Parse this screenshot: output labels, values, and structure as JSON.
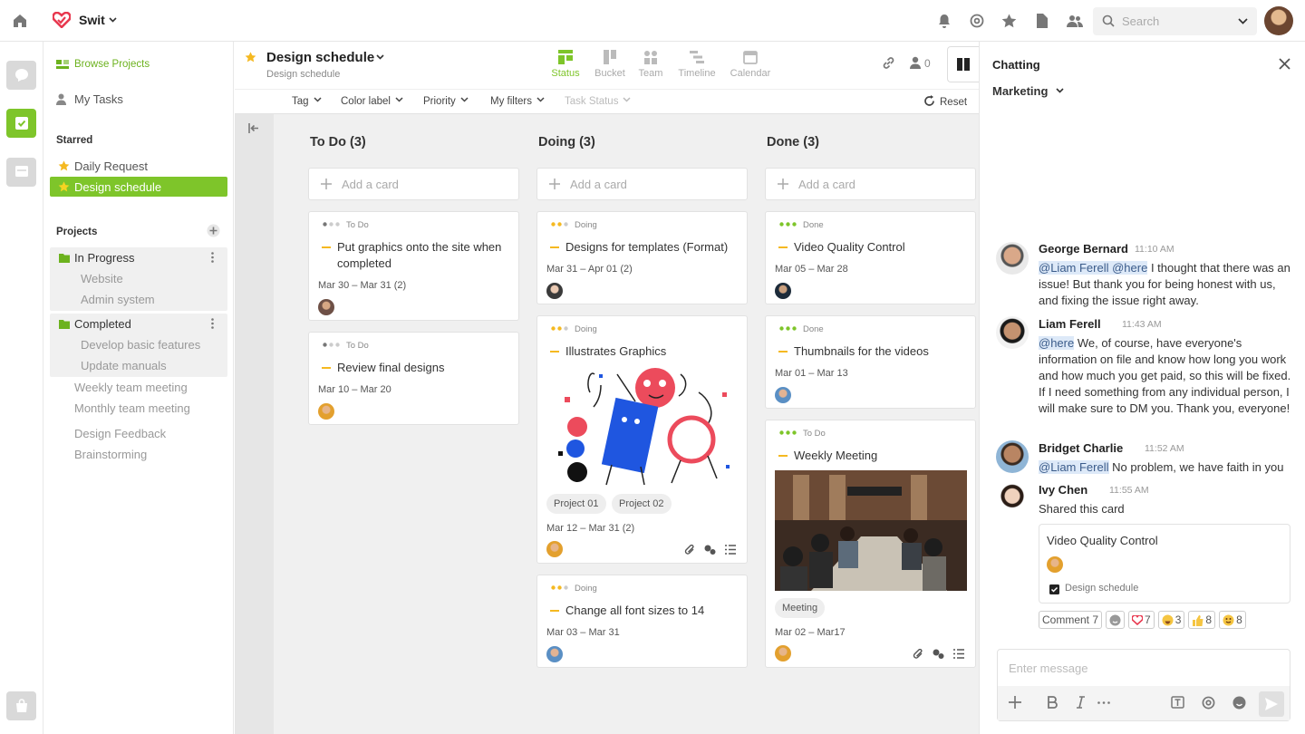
{
  "app": {
    "name": "Swit",
    "accent": "#7ec52a",
    "logo_color": "#e8384f"
  },
  "search": {
    "placeholder": "Search"
  },
  "sidebar": {
    "browse": "Browse Projects",
    "my_tasks": "My Tasks",
    "starred_title": "Starred",
    "starred": [
      {
        "label": "Daily Request"
      },
      {
        "label": "Design schedule",
        "selected": true
      }
    ],
    "projects_title": "Projects",
    "groups": [
      {
        "label": "In Progress",
        "items": [
          "Website",
          "Admin system"
        ]
      },
      {
        "label": "Completed",
        "items": [
          "Develop basic features",
          "Update manuals"
        ]
      }
    ],
    "others": [
      "Weekly team meeting",
      "Monthly team meeting",
      "Design Feedback",
      "Brainstorming"
    ]
  },
  "main": {
    "title": "Design schedule",
    "subtitle": "Design schedule",
    "views": [
      "Status",
      "Bucket",
      "Team",
      "Timeline",
      "Calendar"
    ],
    "active_view": "Status",
    "member_count": "0",
    "filters": [
      "Tag",
      "Color label",
      "Priority",
      "My filters",
      "Task Status"
    ],
    "reset": "Reset",
    "add_card": "Add a card",
    "columns": [
      {
        "title": "To Do (3)",
        "cards": [
          {
            "status": "To Do",
            "title": "Put graphics onto the site when completed",
            "date": "Mar 30 – Mar 31 (2)"
          },
          {
            "status": "To Do",
            "title": "Review final designs",
            "date": "Mar 10 – Mar 20"
          }
        ]
      },
      {
        "title": "Doing (3)",
        "cards": [
          {
            "status": "Doing",
            "title": "Designs for templates (Format)",
            "date": "Mar 31 – Apr 01 (2)"
          },
          {
            "status": "Doing",
            "title": "Illustrates Graphics",
            "tags": [
              "Project 01",
              "Project 02"
            ],
            "date": "Mar 12 – Mar 31 (2)"
          },
          {
            "status": "Doing",
            "title": "Change all font sizes to 14",
            "date": "Mar 03 – Mar 31"
          }
        ]
      },
      {
        "title": "Done (3)",
        "cards": [
          {
            "status": "Done",
            "title": "Video Quality Control",
            "date": "Mar 05 – Mar 28"
          },
          {
            "status": "Done",
            "title": "Thumbnails for the videos",
            "date": "Mar 01 – Mar 13"
          },
          {
            "status": "To Do",
            "title": "Weekly Meeting",
            "tags": [
              "Meeting"
            ],
            "date": "Mar 02 – Mar17"
          }
        ]
      }
    ]
  },
  "chat": {
    "title": "Chatting",
    "channel": "Marketing",
    "messages": [
      {
        "name": "George Bernard",
        "time": "11:10 AM",
        "mention": "@Liam Ferell @here",
        "text": " I thought that there was an issue! But thank you for being honest with us, and fixing the issue right away."
      },
      {
        "name": "Liam Ferell",
        "time": "11:43 AM",
        "mention": "@here",
        "text": " We, of course, have everyone's information on file and know how long you work and how much you get paid, so this will be fixed. If I need something from any individual person, I will make sure to DM you. Thank you, everyone!"
      },
      {
        "name": "Bridget Charlie",
        "time": "11:52 AM",
        "mention": "@Liam Ferell",
        "text": " No problem, we have faith in you"
      },
      {
        "name": "Ivy Chen",
        "time": "11:55 AM",
        "text": "Shared this card"
      }
    ],
    "shared_card": {
      "title": "Video Quality Control",
      "project": "Design schedule"
    },
    "reactions": {
      "comment": "Comment 7",
      "counts": [
        "",
        "7",
        "3",
        "8",
        "8"
      ]
    },
    "composer_placeholder": "Enter message"
  }
}
